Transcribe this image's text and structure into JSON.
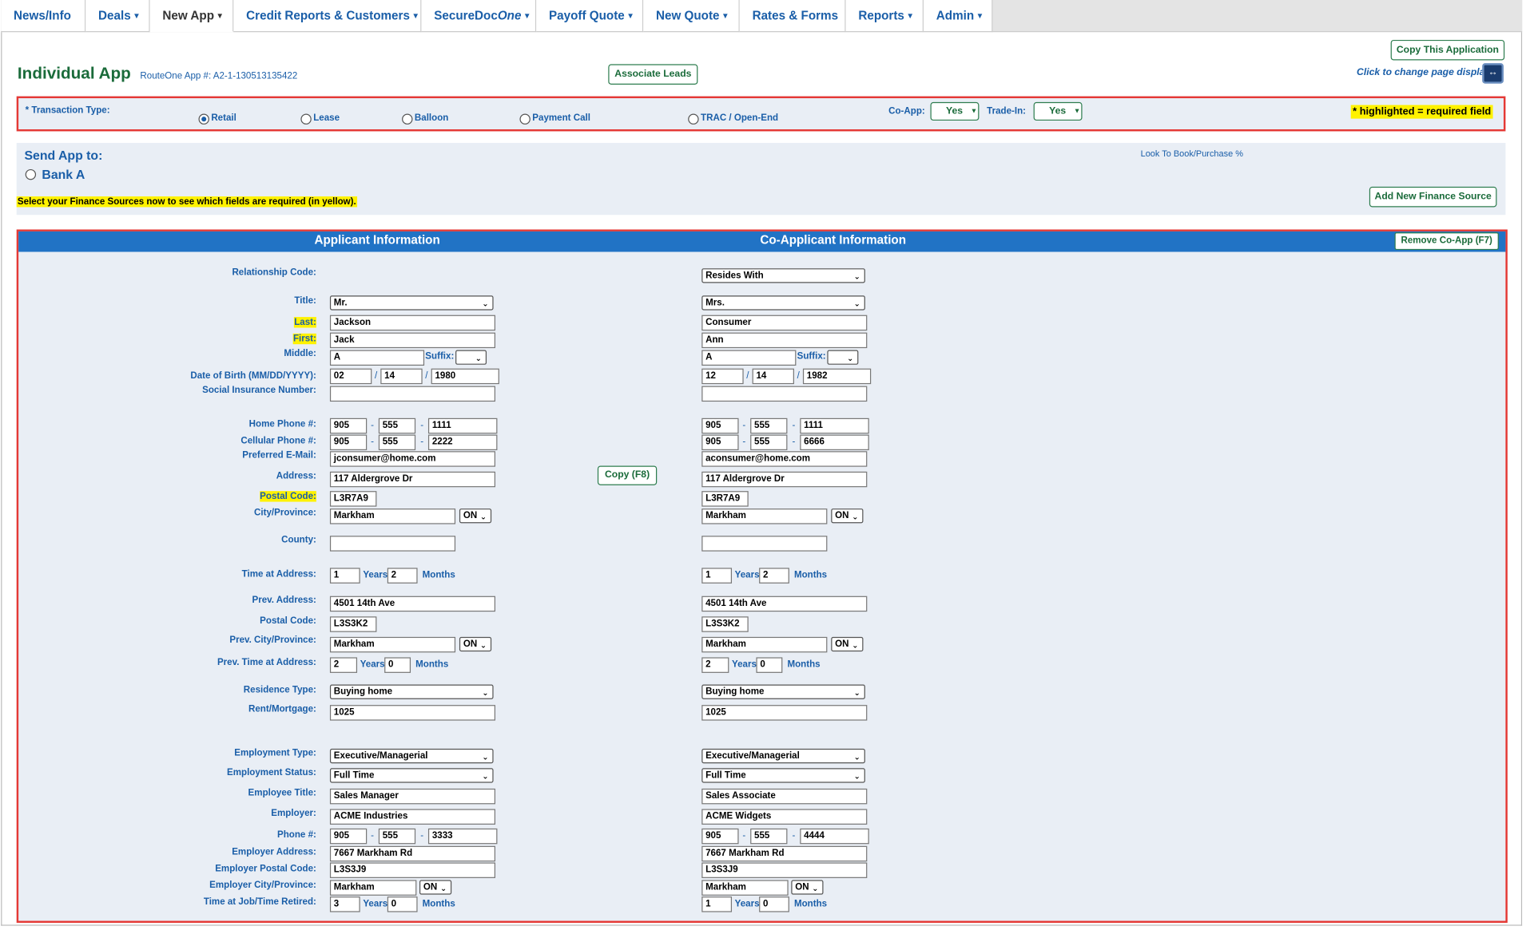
{
  "nav": {
    "tabs": [
      {
        "label": "News/Info",
        "caret": false
      },
      {
        "label": "Deals",
        "caret": true
      },
      {
        "label": "New App",
        "caret": true
      },
      {
        "label": "Credit Reports & Customers",
        "caret": true
      },
      {
        "label": "SecureDoc",
        "suffix": "One",
        "caret": true
      },
      {
        "label": "Payoff Quote",
        "caret": true
      },
      {
        "label": "New Quote",
        "caret": true
      },
      {
        "label": "Rates & Forms",
        "caret": false
      },
      {
        "label": "Reports",
        "caret": true
      },
      {
        "label": "Admin",
        "caret": true
      }
    ]
  },
  "header": {
    "title": "Individual App",
    "app_number": "RouteOne App #: A2-1-130513135422",
    "associate_leads": "Associate Leads",
    "copy_application": "Copy This Application",
    "click_change": "Click to change page display",
    "toggle_icon": "↔"
  },
  "transaction": {
    "label": "* Transaction Type:",
    "options": [
      "Retail",
      "Lease",
      "Balloon",
      "Payment Call",
      "TRAC / Open-End"
    ],
    "selected": "Retail",
    "coapp_label": "Co-App:",
    "coapp_value": "Yes",
    "tradein_label": "Trade-In:",
    "tradein_value": "Yes",
    "required_note": "* highlighted = required field"
  },
  "send_app": {
    "title": "Send App to:",
    "bank": "Bank A",
    "look_to_book": "Look To Book/Purchase %",
    "add_finance_source": "Add New Finance Source",
    "note": "Select your Finance Sources now to see which fields are required (in yellow)."
  },
  "section": {
    "applicant_header": "Applicant Information",
    "coapplicant_header": "Co-Applicant Information",
    "remove_coapp": "Remove Co-App  (F7)",
    "copy_button": "Copy (F8)"
  },
  "labels": {
    "relationship": "Relationship Code:",
    "title": "Title:",
    "last": "Last:",
    "first": "First:",
    "middle": "Middle:",
    "suffix": "Suffix:",
    "dob": "Date of Birth (MM/DD/YYYY):",
    "sin": "Social Insurance Number:",
    "home_phone": "Home Phone #:",
    "cell_phone": "Cellular Phone #:",
    "email": "Preferred E-Mail:",
    "address": "Address:",
    "postal": "Postal Code:",
    "city": "City/Province:",
    "county": "County:",
    "time_address": "Time at Address:",
    "prev_address": "Prev. Address:",
    "prev_postal": "Postal Code:",
    "prev_city": "Prev. City/Province:",
    "prev_time": "Prev. Time at Address:",
    "residence": "Residence Type:",
    "rent": "Rent/Mortgage:",
    "emp_type": "Employment Type:",
    "emp_status": "Employment Status:",
    "emp_title": "Employee Title:",
    "employer": "Employer:",
    "emp_phone": "Phone #:",
    "emp_address": "Employer Address:",
    "emp_postal": "Employer Postal Code:",
    "emp_city": "Employer City/Province:",
    "time_job": "Time at Job/Time Retired:",
    "years": "Years",
    "months": "Months",
    "dash": "-",
    "slash": "/"
  },
  "applicant": {
    "title": "Mr.",
    "last": "Jackson",
    "first": "Jack",
    "middle": "A",
    "suffix": "",
    "dob_mm": "02",
    "dob_dd": "14",
    "dob_yyyy": "1980",
    "sin": "",
    "home_1": "905",
    "home_2": "555",
    "home_3": "1111",
    "cell_1": "905",
    "cell_2": "555",
    "cell_3": "2222",
    "email": "jconsumer@home.com",
    "address": "117 Aldergrove Dr",
    "postal": "L3R7A9",
    "city": "Markham",
    "province": "ON",
    "county": "",
    "time_years": "1",
    "time_months": "2",
    "prev_address": "4501 14th Ave",
    "prev_postal": "L3S3K2",
    "prev_city": "Markham",
    "prev_province": "ON",
    "prev_years": "2",
    "prev_months": "0",
    "residence": "Buying home",
    "rent": "1025",
    "emp_type": "Executive/Managerial",
    "emp_status": "Full Time",
    "emp_title": "Sales Manager",
    "employer": "ACME Industries",
    "emp_ph_1": "905",
    "emp_ph_2": "555",
    "emp_ph_3": "3333",
    "emp_address": "7667 Markham Rd",
    "emp_postal": "L3S3J9",
    "emp_city": "Markham",
    "emp_province": "ON",
    "job_years": "3",
    "job_months": "0"
  },
  "coapplicant": {
    "relationship": "Resides With",
    "title": "Mrs.",
    "last": "Consumer",
    "first": "Ann",
    "middle": "A",
    "suffix": "",
    "dob_mm": "12",
    "dob_dd": "14",
    "dob_yyyy": "1982",
    "sin": "",
    "home_1": "905",
    "home_2": "555",
    "home_3": "1111",
    "cell_1": "905",
    "cell_2": "555",
    "cell_3": "6666",
    "email": "aconsumer@home.com",
    "address": "117 Aldergrove Dr",
    "postal": "L3R7A9",
    "city": "Markham",
    "province": "ON",
    "county": "",
    "time_years": "1",
    "time_months": "2",
    "prev_address": "4501 14th Ave",
    "prev_postal": "L3S3K2",
    "prev_city": "Markham",
    "prev_province": "ON",
    "prev_years": "2",
    "prev_months": "0",
    "residence": "Buying home",
    "rent": "1025",
    "emp_type": "Executive/Managerial",
    "emp_status": "Full Time",
    "emp_title": "Sales Associate",
    "employer": "ACME Widgets",
    "emp_ph_1": "905",
    "emp_ph_2": "555",
    "emp_ph_3": "4444",
    "emp_address": "7667 Markham Rd",
    "emp_postal": "L3S3J9",
    "emp_city": "Markham",
    "emp_province": "ON",
    "job_years": "1",
    "job_months": "0"
  },
  "colors": {
    "brand_green": "#1a6b3a",
    "link_blue": "#1a5ea8",
    "header_blue": "#2173c5",
    "required_yellow": "#fff200",
    "highlight_red": "#e53935"
  }
}
